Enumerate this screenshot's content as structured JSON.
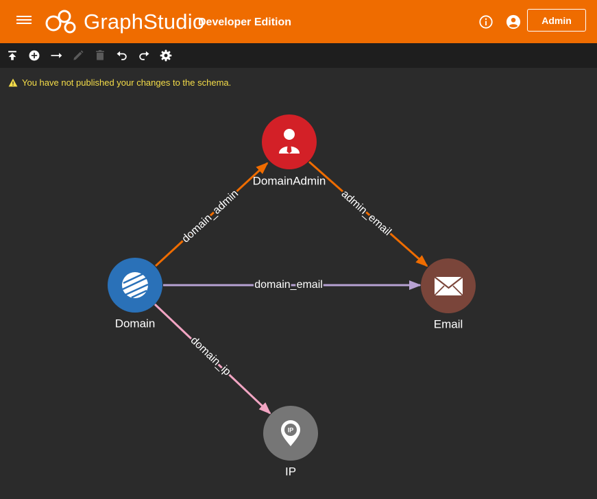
{
  "header": {
    "brand_part1": "Graph",
    "brand_part2": "Studio",
    "edition": "Developer Edition",
    "admin_button": "Admin",
    "color": "#ef6c00"
  },
  "toolbar": {
    "icons": [
      "publish-icon",
      "add-vertex-icon",
      "add-edge-icon",
      "edit-icon",
      "delete-icon",
      "undo-icon",
      "redo-icon",
      "settings-icon"
    ]
  },
  "warning": {
    "text": "You have not published your changes to the schema.",
    "color": "#f5dd49"
  },
  "graph": {
    "vertices": [
      {
        "id": "DomainAdmin",
        "label": "DomainAdmin",
        "color": "#d32027",
        "icon": "person-tie-icon"
      },
      {
        "id": "Domain",
        "label": "Domain",
        "color": "#2a71b8",
        "icon": "globe-icon"
      },
      {
        "id": "Email",
        "label": "Email",
        "color": "#7a453a",
        "icon": "envelope-icon"
      },
      {
        "id": "IP",
        "label": "IP",
        "color": "#767676",
        "icon": "ip-pin-icon"
      }
    ],
    "edges": [
      {
        "from": "Domain",
        "to": "DomainAdmin",
        "label": "domain_admin",
        "color": "#ef6c00"
      },
      {
        "from": "DomainAdmin",
        "to": "Email",
        "label": "admin_email",
        "color": "#ef6c00"
      },
      {
        "from": "Domain",
        "to": "Email",
        "label": "domain_email",
        "color": "#b7a2d3"
      },
      {
        "from": "Domain",
        "to": "IP",
        "label": "domain_ip",
        "color": "#f2a5c3"
      }
    ]
  }
}
